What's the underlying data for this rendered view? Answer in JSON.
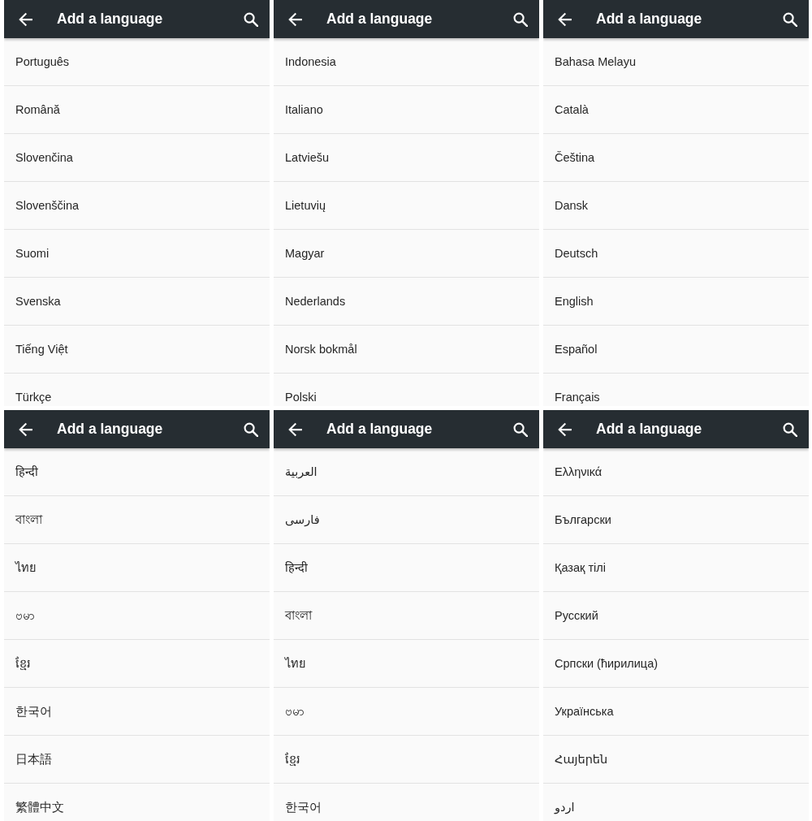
{
  "panels": [
    {
      "title": "Add a language",
      "items": [
        "Português",
        "Română",
        "Slovenčina",
        "Slovenščina",
        "Suomi",
        "Svenska",
        "Tiếng Việt",
        "Türkçe"
      ]
    },
    {
      "title": "Add a language",
      "items": [
        "Indonesia",
        "Italiano",
        "Latviešu",
        "Lietuvių",
        "Magyar",
        "Nederlands",
        "Norsk bokmål",
        "Polski"
      ]
    },
    {
      "title": "Add a language",
      "items": [
        "Bahasa Melayu",
        "Català",
        "Čeština",
        "Dansk",
        "Deutsch",
        "English",
        "Español",
        "Français"
      ]
    },
    {
      "title": "Add a language",
      "items": [
        "हिन्दी",
        "বাংলা",
        "ไทย",
        "ဗမာ",
        "ខ្មែរ",
        "한국어",
        "日本語",
        "繁體中文"
      ]
    },
    {
      "title": "Add a language",
      "items": [
        "العربية",
        "فارسی",
        "हिन्दी",
        "বাংলা",
        "ไทย",
        "ဗမာ",
        "ខ្មែរ",
        "한국어"
      ]
    },
    {
      "title": "Add a language",
      "items": [
        "Ελληνικά",
        "Български",
        "Қазақ тілі",
        "Русский",
        "Српски (ћирилица)",
        "Українська",
        "Հայերեն",
        "اردو"
      ]
    }
  ]
}
